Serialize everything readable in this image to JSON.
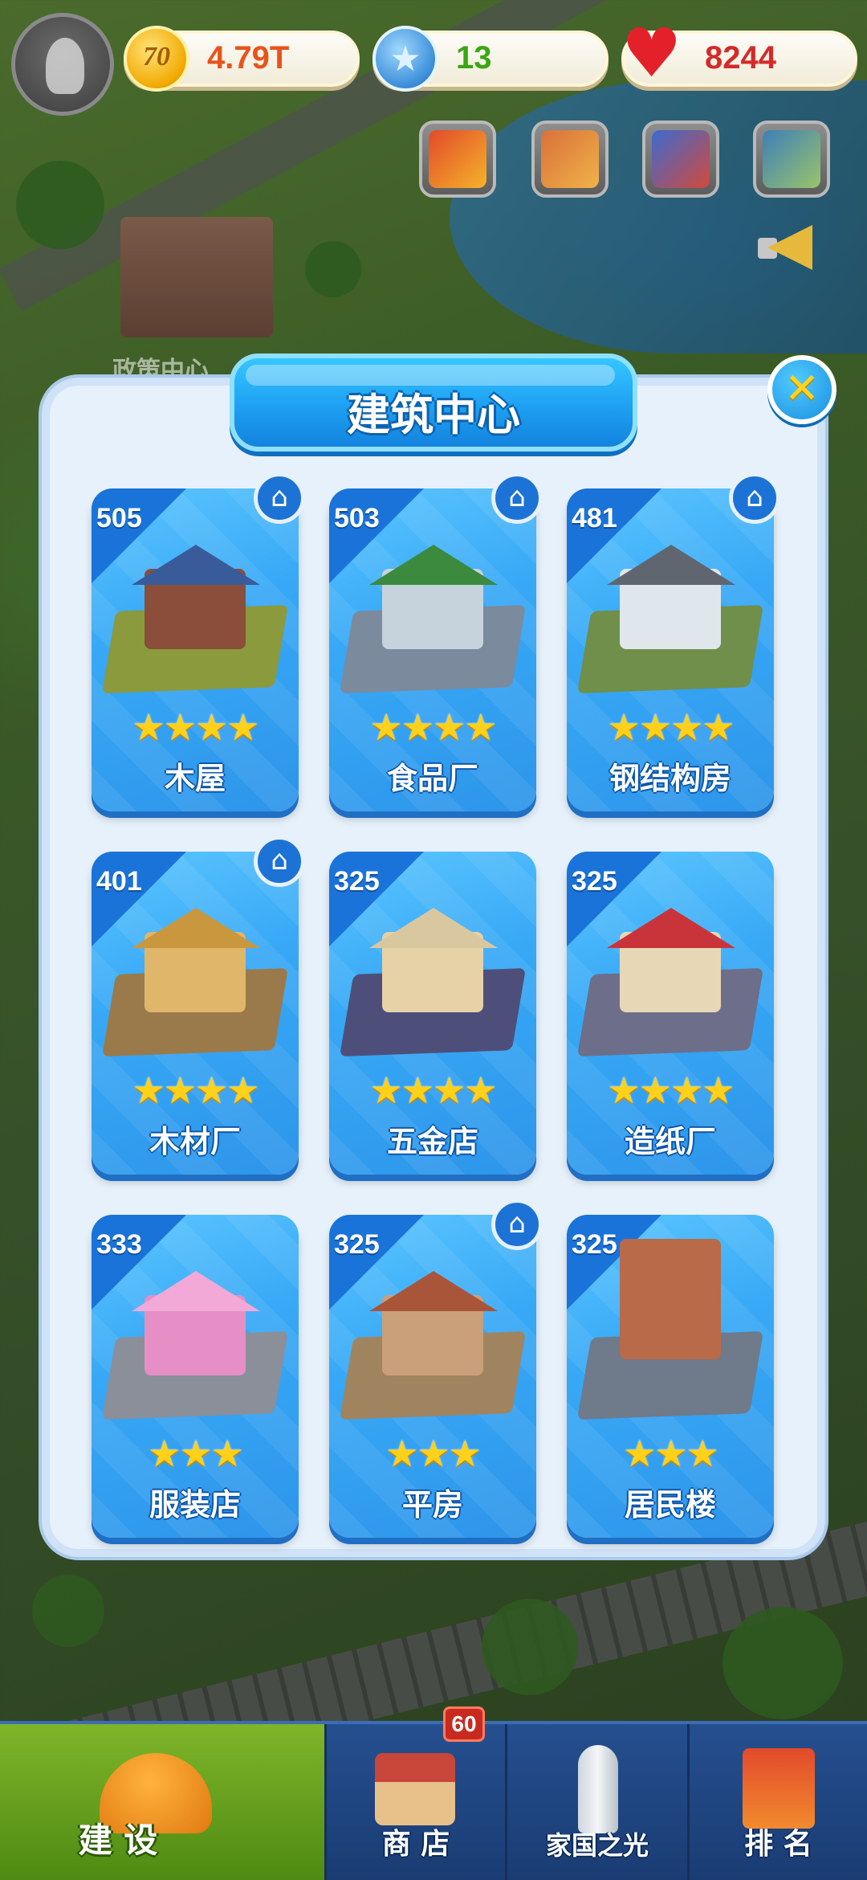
{
  "resources": {
    "coin": {
      "icon": "coin-70-icon",
      "icon_text": "70",
      "value": "4.79T",
      "color": "#e8531a"
    },
    "gem": {
      "icon": "blue-star-gem-icon",
      "value": "13",
      "color": "#3aa614"
    },
    "heart": {
      "icon": "heart-icon",
      "value": "8244",
      "color": "#d42a2a"
    }
  },
  "map_label": "政策中心",
  "dialog": {
    "title": "建筑中心",
    "close_icon": "close-x-icon",
    "cards": [
      {
        "level": "505",
        "name": "木屋",
        "stars": "★★★★",
        "star_count": 4,
        "home": true
      },
      {
        "level": "503",
        "name": "食品厂",
        "stars": "★★★★",
        "star_count": 4,
        "home": true
      },
      {
        "level": "481",
        "name": "钢结构房",
        "stars": "★★★★",
        "star_count": 4,
        "home": true
      },
      {
        "level": "401",
        "name": "木材厂",
        "stars": "★★★★",
        "star_count": 4,
        "home": true
      },
      {
        "level": "325",
        "name": "五金店",
        "stars": "★★★★",
        "star_count": 4,
        "home": false
      },
      {
        "level": "325",
        "name": "造纸厂",
        "stars": "★★★★",
        "star_count": 4,
        "home": false
      },
      {
        "level": "333",
        "name": "服装店",
        "stars": "★★★",
        "star_count": 3,
        "home": false
      },
      {
        "level": "325",
        "name": "平房",
        "stars": "★★★",
        "star_count": 3,
        "home": true
      },
      {
        "level": "325",
        "name": "居民楼",
        "stars": "★★★",
        "star_count": 3,
        "home": false
      }
    ]
  },
  "bottom_nav": {
    "build": "建 设",
    "shop": "商 店",
    "shop_badge": "60",
    "glory": "家国之光",
    "rank": "排 名"
  },
  "colors": {
    "accent": "#2d95ea",
    "active_tab": "#7fb52a",
    "star": "#ffd11a"
  }
}
